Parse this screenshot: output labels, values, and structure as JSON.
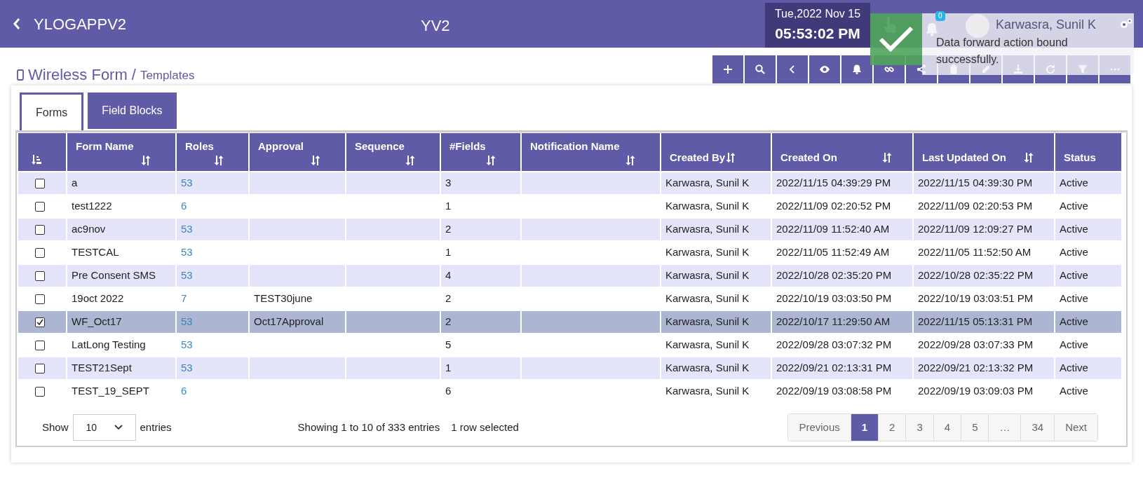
{
  "app": {
    "title": "YLOGAPPV2",
    "center_title": "YV2",
    "date": "Tue,2022 Nov 15",
    "time": "05:53:02 PM",
    "notification_count": "0",
    "user": "Karwasra, Sunil K"
  },
  "toast": {
    "message": "Data forward action bound successfully."
  },
  "breadcrumb": {
    "section": "Wireless Form",
    "separator": "/",
    "page": "Templates"
  },
  "tabs": [
    {
      "label": "Forms",
      "selected": true
    },
    {
      "label": "Field Blocks",
      "selected": false
    }
  ],
  "table": {
    "columns": [
      {
        "label": "Form Name",
        "sortable": true
      },
      {
        "label": "Roles",
        "sortable": true
      },
      {
        "label": "Approval",
        "sortable": true
      },
      {
        "label": "Sequence",
        "sortable": true
      },
      {
        "label": "#Fields",
        "sortable": true
      },
      {
        "label": "Notification Name",
        "sortable": true
      },
      {
        "label": "Created By",
        "sortable": true
      },
      {
        "label": "Created On",
        "sortable": true
      },
      {
        "label": "Last Updated On",
        "sortable": true
      },
      {
        "label": "Status",
        "sortable": false
      }
    ],
    "rows": [
      {
        "selected": false,
        "cells": [
          "a",
          "53",
          "",
          "",
          "3",
          "",
          "Karwasra, Sunil K",
          "2022/11/15 04:39:29 PM",
          "2022/11/15 04:39:30 PM",
          "Active"
        ]
      },
      {
        "selected": false,
        "cells": [
          "test1222",
          "6",
          "",
          "",
          "1",
          "",
          "Karwasra, Sunil K",
          "2022/11/09 02:20:52 PM",
          "2022/11/09 02:20:53 PM",
          "Active"
        ]
      },
      {
        "selected": false,
        "cells": [
          "ac9nov",
          "53",
          "",
          "",
          "2",
          "",
          "Karwasra, Sunil K",
          "2022/11/09 11:52:40 AM",
          "2022/11/09 12:09:27 PM",
          "Active"
        ]
      },
      {
        "selected": false,
        "cells": [
          "TESTCAL",
          "53",
          "",
          "",
          "1",
          "",
          "Karwasra, Sunil K",
          "2022/11/05 11:52:49 AM",
          "2022/11/05 11:52:50 AM",
          "Active"
        ]
      },
      {
        "selected": false,
        "cells": [
          "Pre Consent SMS",
          "53",
          "",
          "",
          "4",
          "",
          "Karwasra, Sunil K",
          "2022/10/28 02:35:20 PM",
          "2022/10/28 02:35:22 PM",
          "Active"
        ]
      },
      {
        "selected": false,
        "cells": [
          "19oct 2022",
          "7",
          "TEST30june",
          "",
          "2",
          "",
          "Karwasra, Sunil K",
          "2022/10/19 03:03:50 PM",
          "2022/10/19 03:03:51 PM",
          "Active"
        ]
      },
      {
        "selected": true,
        "cells": [
          "WF_Oct17",
          "53",
          "Oct17Approval",
          "",
          "2",
          "",
          "Karwasra, Sunil K",
          "2022/10/17 11:29:50 AM",
          "2022/11/15 05:13:31 PM",
          "Active"
        ]
      },
      {
        "selected": false,
        "cells": [
          "LatLong Testing",
          "53",
          "",
          "",
          "5",
          "",
          "Karwasra, Sunil K",
          "2022/09/28 03:07:32 PM",
          "2022/09/28 03:07:33 PM",
          "Active"
        ]
      },
      {
        "selected": false,
        "cells": [
          "TEST21Sept",
          "53",
          "",
          "",
          "1",
          "",
          "Karwasra, Sunil K",
          "2022/09/21 02:13:31 PM",
          "2022/09/21 02:13:32 PM",
          "Active"
        ]
      },
      {
        "selected": false,
        "cells": [
          "TEST_19_SEPT",
          "6",
          "",
          "",
          "6",
          "",
          "Karwasra, Sunil K",
          "2022/09/19 03:08:58 PM",
          "2022/09/19 03:09:03 PM",
          "Active"
        ]
      }
    ]
  },
  "footer": {
    "show_label": "Show",
    "page_size": "10",
    "entries_label": "entries",
    "info": "Showing 1 to 10 of 333 entries",
    "selection_info": "1 row selected",
    "pages": [
      {
        "label": "Previous",
        "selected": false
      },
      {
        "label": "1",
        "selected": true
      },
      {
        "label": "2",
        "selected": false
      },
      {
        "label": "3",
        "selected": false
      },
      {
        "label": "4",
        "selected": false
      },
      {
        "label": "5",
        "selected": false
      },
      {
        "label": "…",
        "selected": false
      },
      {
        "label": "34",
        "selected": false
      },
      {
        "label": "Next",
        "selected": false
      }
    ]
  }
}
